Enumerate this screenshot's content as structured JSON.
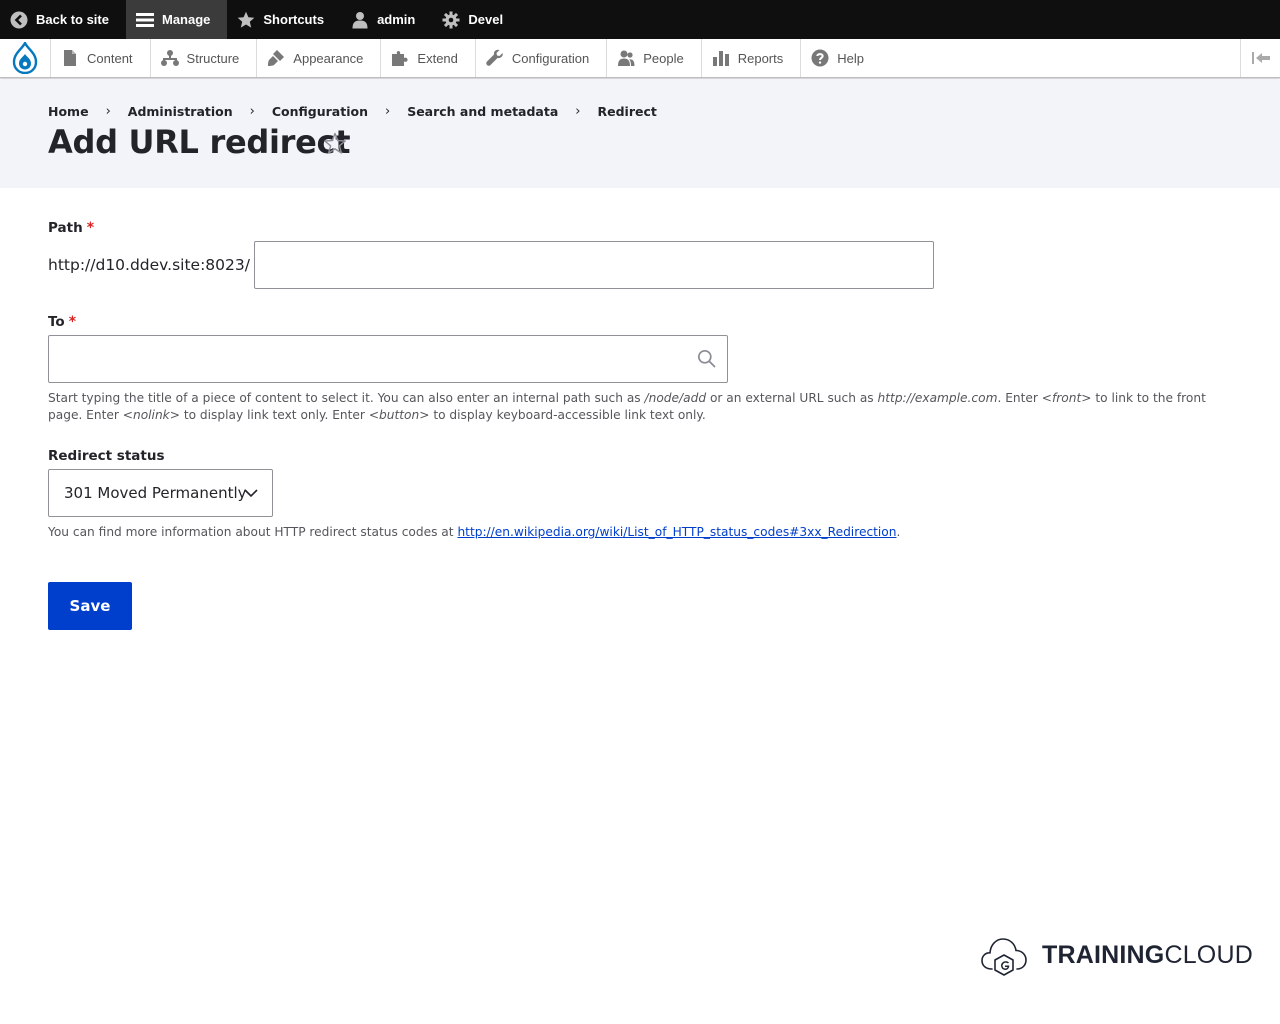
{
  "toolbar": {
    "items": [
      {
        "label": "Back to site",
        "icon": "back-arrow-icon"
      },
      {
        "label": "Manage",
        "icon": "hamburger-menu-icon",
        "active": true
      },
      {
        "label": "Shortcuts",
        "icon": "star-icon"
      },
      {
        "label": "admin",
        "icon": "user-icon"
      },
      {
        "label": "Devel",
        "icon": "gear-icon"
      }
    ]
  },
  "tray": {
    "items": [
      {
        "label": "Content",
        "icon": "file-icon"
      },
      {
        "label": "Structure",
        "icon": "sitemap-icon"
      },
      {
        "label": "Appearance",
        "icon": "paint-brush-icon"
      },
      {
        "label": "Extend",
        "icon": "puzzle-icon"
      },
      {
        "label": "Configuration",
        "icon": "wrench-icon"
      },
      {
        "label": "People",
        "icon": "people-icon"
      },
      {
        "label": "Reports",
        "icon": "bar-chart-icon"
      },
      {
        "label": "Help",
        "icon": "help-icon"
      }
    ]
  },
  "breadcrumb": [
    "Home",
    "Administration",
    "Configuration",
    "Search and metadata",
    "Redirect"
  ],
  "page": {
    "title": "Add URL redirect"
  },
  "form": {
    "path": {
      "label": "Path",
      "required": "*",
      "prefix": "http://d10.ddev.site:8023/",
      "value": ""
    },
    "to": {
      "label": "To",
      "required": "*",
      "value": "",
      "desc_parts": [
        "Start typing the title of a piece of content to select it. You can also enter an internal path such as ",
        "/node/add",
        " or an external URL such as ",
        "http://example.com",
        ". Enter ",
        "<front>",
        " to link to the front page. Enter ",
        "<nolink>",
        " to display link text only. Enter ",
        "<button>",
        " to display keyboard-accessible link text only."
      ]
    },
    "status": {
      "label": "Redirect status",
      "selected": "301 Moved Permanently",
      "desc_prefix": "You can find more information about HTTP redirect status codes at ",
      "link": "http://en.wikipedia.org/wiki/List_of_HTTP_status_codes#3xx_Redirection",
      "desc_suffix": "."
    },
    "save_label": "Save"
  },
  "watermark": {
    "bold": "TRAINING",
    "regular": "CLOUD"
  },
  "colors": {
    "toolbar_bg": "#0f0f0f",
    "header_bg": "#f3f4f9",
    "primary": "#003ecc",
    "required": "#dc2323",
    "drupal_blue": "#0678be"
  }
}
